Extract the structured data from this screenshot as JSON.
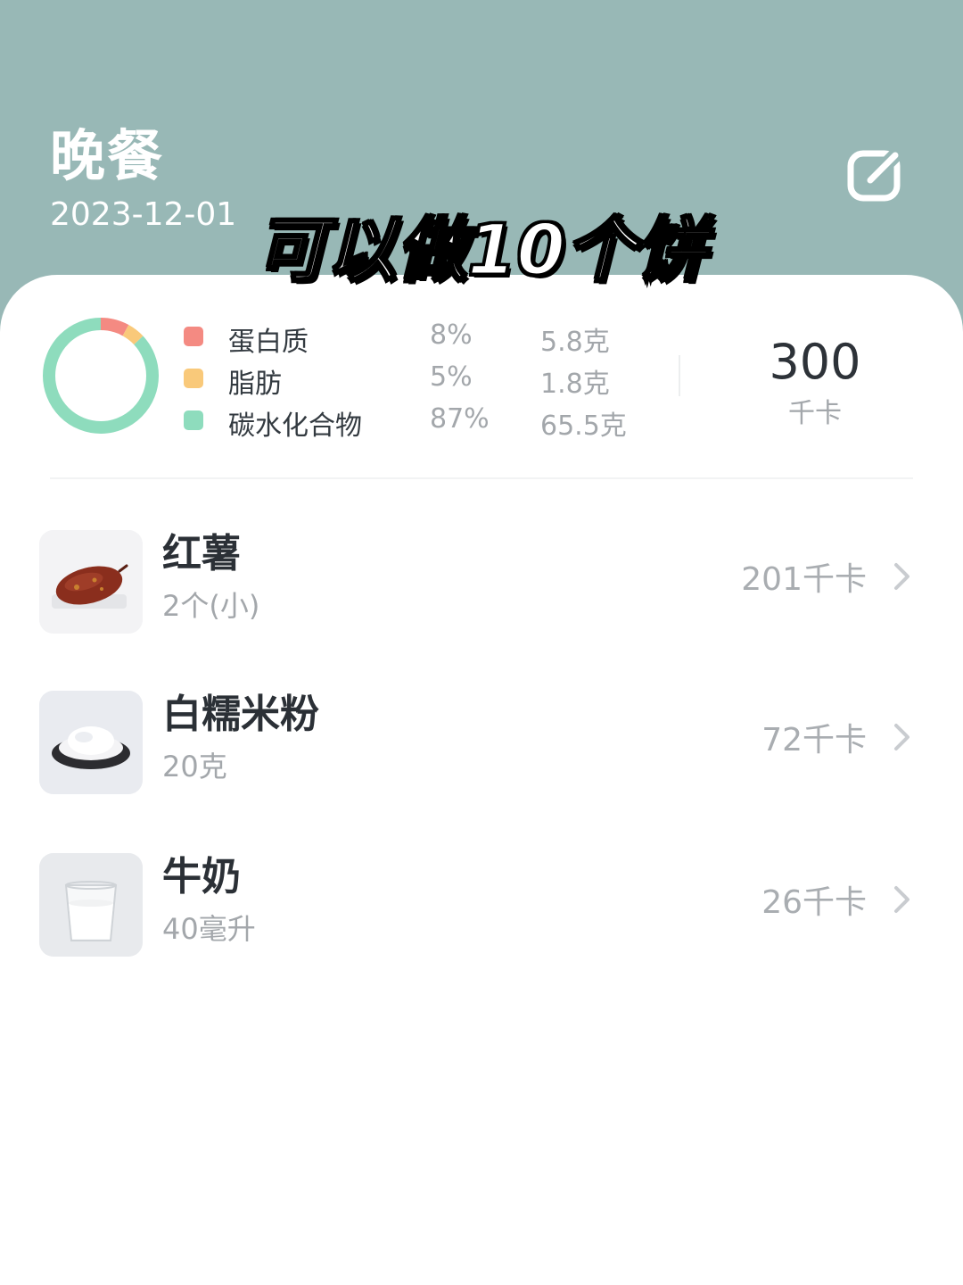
{
  "header": {
    "title": "晚餐",
    "date": "2023-12-01",
    "edit_icon": "edit-icon",
    "background_color": "#98b8b6"
  },
  "overlay_caption": "可以做10个饼",
  "nutrition": {
    "macros": [
      {
        "name": "蛋白质",
        "percent": "8%",
        "amount": "5.8克",
        "color": "#f48a82",
        "share": 0.08
      },
      {
        "name": "脂肪",
        "percent": "5%",
        "amount": "1.8克",
        "color": "#f9c97a",
        "share": 0.05
      },
      {
        "name": "碳水化合物",
        "percent": "87%",
        "amount": "65.5克",
        "color": "#8edcbd",
        "share": 0.87
      }
    ],
    "total_kcal": "300",
    "total_unit": "千卡"
  },
  "foods": [
    {
      "name": "红薯",
      "quantity": "2个(小)",
      "kcal": "201千卡",
      "thumb_icon": "sweet-potato-icon"
    },
    {
      "name": "白糯米粉",
      "quantity": "20克",
      "kcal": "72千卡",
      "thumb_icon": "rice-flour-icon"
    },
    {
      "name": "牛奶",
      "quantity": "40毫升",
      "kcal": "26千卡",
      "thumb_icon": "milk-glass-icon"
    }
  ]
}
